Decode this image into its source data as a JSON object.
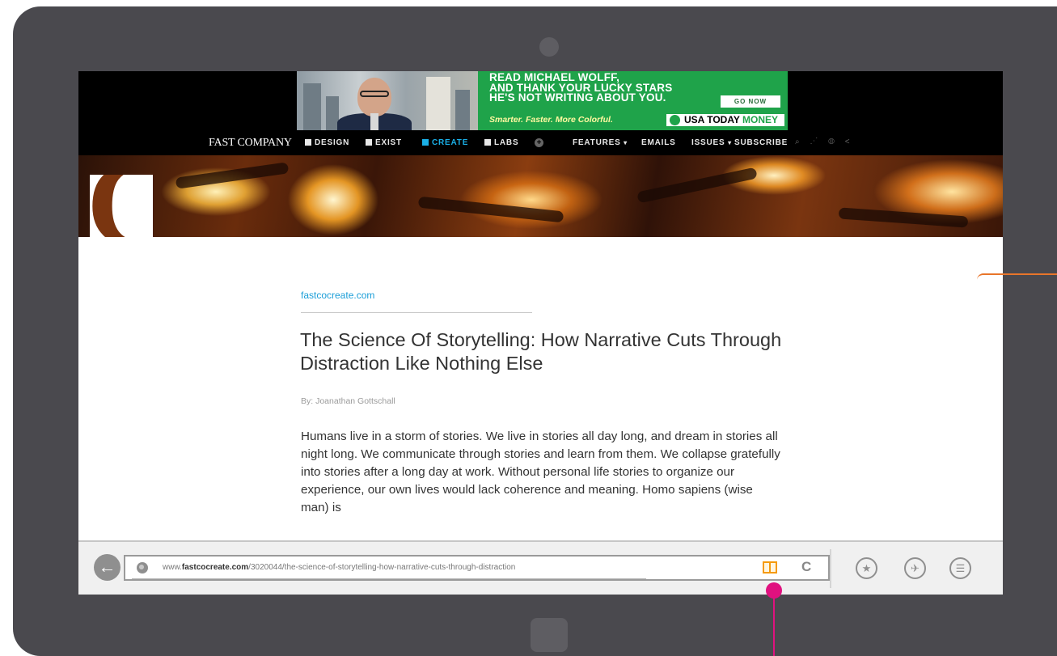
{
  "ad": {
    "headline_1": "READ MICHAEL WOLFF,",
    "headline_2": "AND THANK YOUR LUCKY STARS",
    "headline_3": "HE'S NOT WRITING ABOUT YOU.",
    "tagline": "Smarter. Faster. More Colorful.",
    "cta": "GO NOW",
    "brand": "USA TODAY",
    "brand_accent": "MONEY",
    "accent_color": "#1fa34a"
  },
  "nav": {
    "logo": "FAST COMPANY",
    "items": [
      {
        "label": "DESIGN",
        "icon": "design-icon"
      },
      {
        "label": "EXIST",
        "icon": "exist-icon"
      },
      {
        "label": "CREATE",
        "icon": "create-icon",
        "active": true
      },
      {
        "label": "LABS",
        "icon": "labs-icon"
      }
    ],
    "plus_icon": "+",
    "right_items": [
      "FEATURES",
      "EMAILS",
      "ISSUES",
      "SUBSCRIBE"
    ],
    "caret": "▾",
    "tool_icons": [
      "search-icon",
      "rss-icon",
      "globe-icon",
      "share-icon"
    ],
    "tool_glyphs": "⌕ ⋰ ◍ <",
    "active_color": "#1ab0e8"
  },
  "banner": {
    "section_letter": "C"
  },
  "article": {
    "site": "fastcocreate.com",
    "title": "The Science Of Storytelling: How Narrative Cuts Through Distraction Like Nothing Else",
    "byline": "By: Joanathan Gottschall",
    "body": "Humans live in a storm of stories. We live in stories all day long, and dream in stories all night long. We communicate through stories and learn from them. We collapse gratefully into stories after a long day at work. Without personal life stories to organize our experience, our own lives would lack coherence and meaning. Homo sapiens (wise man) is"
  },
  "browser": {
    "back_glyph": "←",
    "url_prefix": "www.",
    "url_domain": "fastcocreate.com",
    "url_path": "/3020044/the-science-of-storytelling-how-narrative-cuts-through-distraction",
    "refresh_glyph": "C",
    "favorite_glyph": "★",
    "pin_glyph": "✈",
    "menu_glyph": "☰",
    "reader_color": "#f59a0c"
  },
  "annotations": {
    "pink": "#e0117f",
    "orange": "#e8752a"
  }
}
